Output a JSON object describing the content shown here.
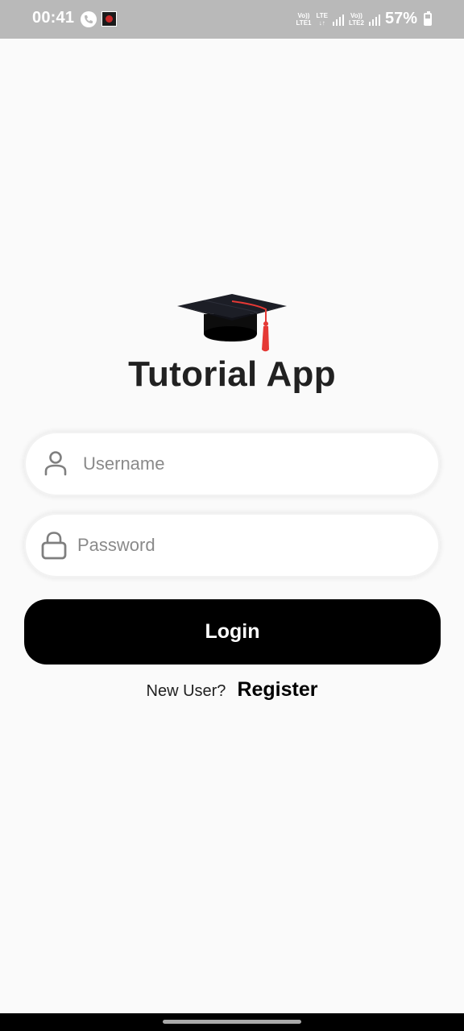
{
  "status_bar": {
    "time": "00:41",
    "call_icon": "phone-call-icon",
    "app_icon": "download-app-icon",
    "sim1_label_top": "Vo))",
    "sim1_label_bottom": "LTE1",
    "data_label_top": "LTE",
    "data_label_bottom": "↓↑",
    "sim2_label_top": "Vo))",
    "sim2_label_bottom": "LTE2",
    "battery_percent": "57%",
    "battery_level": 0.57
  },
  "app": {
    "logo_icon": "graduation-cap-icon",
    "title": "Tutorial App"
  },
  "login_form": {
    "username": {
      "icon": "user-icon",
      "placeholder": "Username",
      "value": ""
    },
    "password": {
      "icon": "lock-icon",
      "placeholder": "Password",
      "value": ""
    },
    "login_label": "Login",
    "new_user_text": "New User?",
    "register_label": "Register"
  },
  "colors": {
    "background": "#fafafa",
    "status_bar": "#b9b9b9",
    "button": "#000000",
    "title_text": "#212121",
    "placeholder": "#8a8a8a",
    "tassel": "#e53935"
  }
}
